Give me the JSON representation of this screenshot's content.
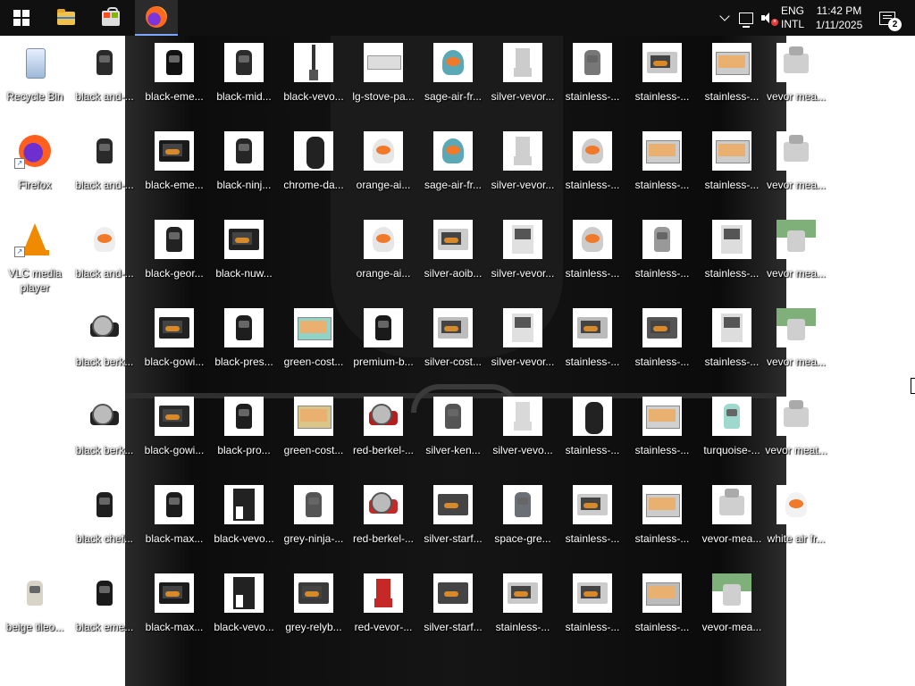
{
  "taskbar": {
    "apps": [
      {
        "name": "Start",
        "icon": "windows-start-icon"
      },
      {
        "name": "File Explorer",
        "icon": "folder-icon"
      },
      {
        "name": "Microsoft Store",
        "icon": "store-icon"
      },
      {
        "name": "Firefox",
        "icon": "firefox-icon",
        "active": true
      }
    ],
    "tray": {
      "lang_top": "ENG",
      "lang_bottom": "INTL",
      "time": "11:42 PM",
      "date": "1/11/2025",
      "notification_count": "2"
    }
  },
  "desktop": {
    "columns": [
      [
        {
          "label": "Recycle Bin",
          "kind": "recycle"
        },
        {
          "label": "Firefox",
          "kind": "ff",
          "shortcut": true
        },
        {
          "label": "VLC media player",
          "kind": "vlc",
          "shortcut": true,
          "wrap": true
        },
        null,
        null,
        null,
        {
          "label": "beige tileo...",
          "kind": "fryer",
          "color": "#d9d4c8"
        }
      ],
      [
        {
          "label": "black and-...",
          "kind": "fryer",
          "color": "#2a2a2a"
        },
        {
          "label": "black and-...",
          "kind": "fryer",
          "color": "#2a2a2a"
        },
        {
          "label": "black and-...",
          "kind": "round",
          "color": "#eeeeee"
        },
        {
          "label": "black berk...",
          "kind": "slicer",
          "color": "#222222"
        },
        {
          "label": "black berk...",
          "kind": "slicer",
          "color": "#222222"
        },
        {
          "label": "black chef...",
          "kind": "fryer",
          "color": "#1f1f1f"
        },
        {
          "label": "black eme...",
          "kind": "fryer",
          "color": "#1a1a1a"
        }
      ],
      [
        {
          "label": "black-eme...",
          "kind": "fryer",
          "color": "#111111"
        },
        {
          "label": "black-eme...",
          "kind": "oven",
          "color": "#1a1a1a"
        },
        {
          "label": "black-geor...",
          "kind": "fryer",
          "color": "#222222"
        },
        {
          "label": "black-gowi...",
          "kind": "oven",
          "color": "#222222"
        },
        {
          "label": "black-gowi...",
          "kind": "oven",
          "color": "#2a2a2a"
        },
        {
          "label": "black-max...",
          "kind": "fryer",
          "color": "#1c1c1c"
        },
        {
          "label": "black-max...",
          "kind": "oven",
          "color": "#1c1c1c"
        }
      ],
      [
        {
          "label": "black-mid...",
          "kind": "fryer",
          "color": "#2b2b2b"
        },
        {
          "label": "black-ninj...",
          "kind": "fryer",
          "color": "#262626"
        },
        {
          "label": "black-nuw...",
          "kind": "oven",
          "color": "#222222"
        },
        {
          "label": "black-pres...",
          "kind": "fryer",
          "color": "#1e1e1e"
        },
        {
          "label": "black-pro...",
          "kind": "fryer",
          "color": "#1e1e1e"
        },
        {
          "label": "black-vevo...",
          "kind": "door",
          "color": "#222222"
        },
        {
          "label": "black-vevo...",
          "kind": "door",
          "color": "#222222"
        }
      ],
      [
        {
          "label": "black-vevo...",
          "kind": "stick",
          "color": "#333333"
        },
        {
          "label": "chrome-da...",
          "kind": "cable",
          "color": "#222222"
        },
        null,
        {
          "label": "green-cost...",
          "kind": "display",
          "color": "#8fd3c9"
        },
        {
          "label": "green-cost...",
          "kind": "display",
          "color": "#d9c48a"
        },
        {
          "label": "grey-ninja-...",
          "kind": "fryer",
          "color": "#555555"
        },
        {
          "label": "grey-relyb...",
          "kind": "oven",
          "color": "#3a3a3a"
        }
      ],
      [
        {
          "label": "lg-stove-pa...",
          "kind": "pan",
          "color": "#dddddd"
        },
        {
          "label": "orange-ai...",
          "kind": "round",
          "color": "#e6e6e6"
        },
        {
          "label": "orange-ai...",
          "kind": "round",
          "color": "#e6e6e6"
        },
        {
          "label": "premium-b...",
          "kind": "fryer",
          "color": "#1a1a1a"
        },
        {
          "label": "red-berkel-...",
          "kind": "slicer",
          "color": "#b71c1c"
        },
        {
          "label": "red-berkel-...",
          "kind": "slicer",
          "color": "#c62828"
        },
        {
          "label": "red-vevor-...",
          "kind": "blender",
          "color": "#c62828"
        }
      ],
      [
        {
          "label": "sage-air-fr...",
          "kind": "round",
          "color": "#5aa7b5"
        },
        {
          "label": "sage-air-fr...",
          "kind": "round",
          "color": "#5aa7b5"
        },
        {
          "label": "silver-aoib...",
          "kind": "oven",
          "color": "#cccccc"
        },
        {
          "label": "silver-cost...",
          "kind": "oven",
          "color": "#bdbdbd"
        },
        {
          "label": "silver-ken...",
          "kind": "fryer",
          "color": "#555555"
        },
        {
          "label": "silver-starf...",
          "kind": "oven",
          "color": "#444444"
        },
        {
          "label": "silver-starf...",
          "kind": "oven",
          "color": "#444444"
        }
      ],
      [
        {
          "label": "silver-vevor...",
          "kind": "blender",
          "color": "#cccccc"
        },
        {
          "label": "silver-vevor...",
          "kind": "blender",
          "color": "#cfcfcf"
        },
        {
          "label": "silver-vevor...",
          "kind": "dispenser",
          "color": "#e0e0e0"
        },
        {
          "label": "silver-vevor...",
          "kind": "dispenser",
          "color": "#e0e0e0"
        },
        {
          "label": "silver-vevo...",
          "kind": "blender",
          "color": "#d9d9d9"
        },
        {
          "label": "space-gre...",
          "kind": "fryer",
          "color": "#6b7077"
        },
        {
          "label": "stainless-...",
          "kind": "oven",
          "color": "#c8c8c8"
        }
      ],
      [
        {
          "label": "stainless-...",
          "kind": "fryer",
          "color": "#777777"
        },
        {
          "label": "stainless-...",
          "kind": "round",
          "color": "#cccccc"
        },
        {
          "label": "stainless-...",
          "kind": "round",
          "color": "#cccccc"
        },
        {
          "label": "stainless-...",
          "kind": "oven",
          "color": "#bbbbbb"
        },
        {
          "label": "stainless-...",
          "kind": "cable",
          "color": "#222222"
        },
        {
          "label": "stainless-...",
          "kind": "oven",
          "color": "#cccccc"
        },
        {
          "label": "stainless-...",
          "kind": "oven",
          "color": "#cccccc"
        }
      ],
      [
        {
          "label": "stainless-...",
          "kind": "oven",
          "color": "#c8c8c8"
        },
        {
          "label": "stainless-...",
          "kind": "display",
          "color": "#cccccc"
        },
        {
          "label": "stainless-...",
          "kind": "fryer",
          "color": "#999999"
        },
        {
          "label": "stainless-...",
          "kind": "oven",
          "color": "#555555"
        },
        {
          "label": "stainless-...",
          "kind": "display",
          "color": "#d0d0d0"
        },
        {
          "label": "stainless-...",
          "kind": "display",
          "color": "#cccccc"
        },
        {
          "label": "stainless-...",
          "kind": "display",
          "color": "#bbbbbb"
        }
      ],
      [
        {
          "label": "stainless-...",
          "kind": "display",
          "color": "#cccccc"
        },
        {
          "label": "stainless-...",
          "kind": "display",
          "color": "#cccccc"
        },
        {
          "label": "stainless-...",
          "kind": "dispenser",
          "color": "#dddddd"
        },
        {
          "label": "stainless-...",
          "kind": "dispenser",
          "color": "#dddddd"
        },
        {
          "label": "turquoise-...",
          "kind": "fryer",
          "color": "#9fd8cc"
        },
        {
          "label": "vevor-mea...",
          "kind": "mixer",
          "color": "#cfcfcf"
        },
        {
          "label": "vevor-mea...",
          "kind": "photo",
          "color": "#cfcfcf"
        }
      ],
      [
        {
          "label": "vevor mea...",
          "kind": "mixer",
          "color": "#cfcfcf"
        },
        {
          "label": "vevor mea...",
          "kind": "mixer",
          "color": "#cfcfcf"
        },
        {
          "label": "vevor mea...",
          "kind": "photo",
          "color": "#cfcfcf"
        },
        {
          "label": "vevor mea...",
          "kind": "photo",
          "color": "#cfcfcf"
        },
        {
          "label": "vevor meat...",
          "kind": "mixer",
          "color": "#cfcfcf"
        },
        {
          "label": "white air fr...",
          "kind": "round",
          "color": "#f2f2f2"
        },
        null
      ]
    ]
  }
}
